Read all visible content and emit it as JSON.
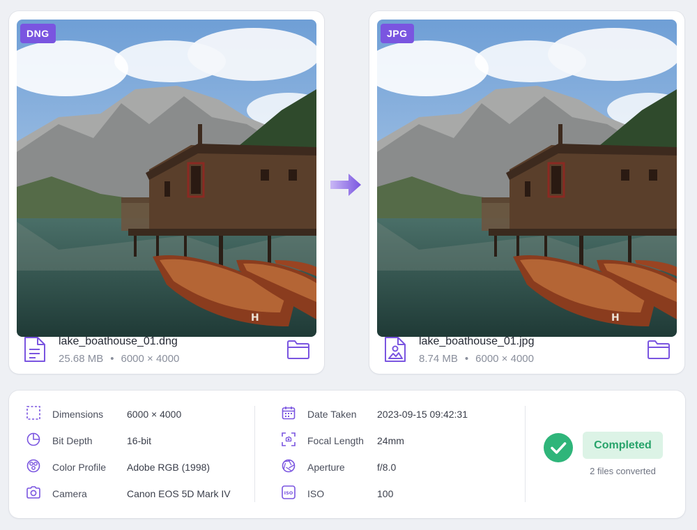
{
  "source": {
    "format_badge": "DNG",
    "file_name": "lake_boathouse_01.dng",
    "file_size": "25.68 MB",
    "dimensions": "6000 × 4000"
  },
  "output": {
    "format_badge": "JPG",
    "file_name": "lake_boathouse_01.jpg",
    "file_size": "8.74 MB",
    "dimensions": "6000 × 4000"
  },
  "separator": "•",
  "metadata": {
    "left": [
      {
        "icon": "dimensions-icon",
        "label": "Dimensions",
        "value": "6000 × 4000"
      },
      {
        "icon": "bit-depth-icon",
        "label": "Bit Depth",
        "value": "16-bit"
      },
      {
        "icon": "color-profile-icon",
        "label": "Color Profile",
        "value": "Adobe RGB (1998)"
      },
      {
        "icon": "camera-icon",
        "label": "Camera",
        "value": "Canon EOS 5D Mark IV"
      }
    ],
    "right": [
      {
        "icon": "calendar-icon",
        "label": "Date Taken",
        "value": "2023-09-15 09:42:31"
      },
      {
        "icon": "focal-length-icon",
        "label": "Focal Length",
        "value": "24mm"
      },
      {
        "icon": "aperture-icon",
        "label": "Aperture",
        "value": "f/8.0"
      },
      {
        "icon": "iso-icon",
        "label": "ISO",
        "value": "100"
      }
    ]
  },
  "status": {
    "label": "Completed",
    "detail": "2 files converted"
  },
  "colors": {
    "accent": "#7a55e0",
    "success": "#2fb57a",
    "success_bg": "#dcf3e6"
  }
}
